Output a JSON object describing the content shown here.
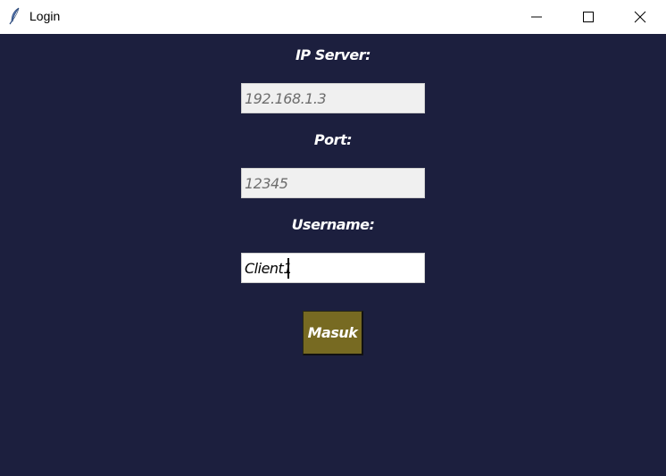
{
  "window": {
    "title": "Login",
    "icon": "feather-icon",
    "controls": [
      "minimize-icon",
      "maximize-icon",
      "close-icon"
    ]
  },
  "form": {
    "ip_label": "IP Server:",
    "ip_value": "192.168.1.3",
    "port_label": "Port:",
    "port_value": "12345",
    "username_label": "Username:",
    "username_value": "Client1",
    "submit_label": "Masuk"
  },
  "colors": {
    "background": "#1c1f3e",
    "button": "#776a22",
    "label_text": "#ffffff",
    "disabled_field": "#f0f0f0",
    "disabled_text": "#6d6d6d"
  }
}
